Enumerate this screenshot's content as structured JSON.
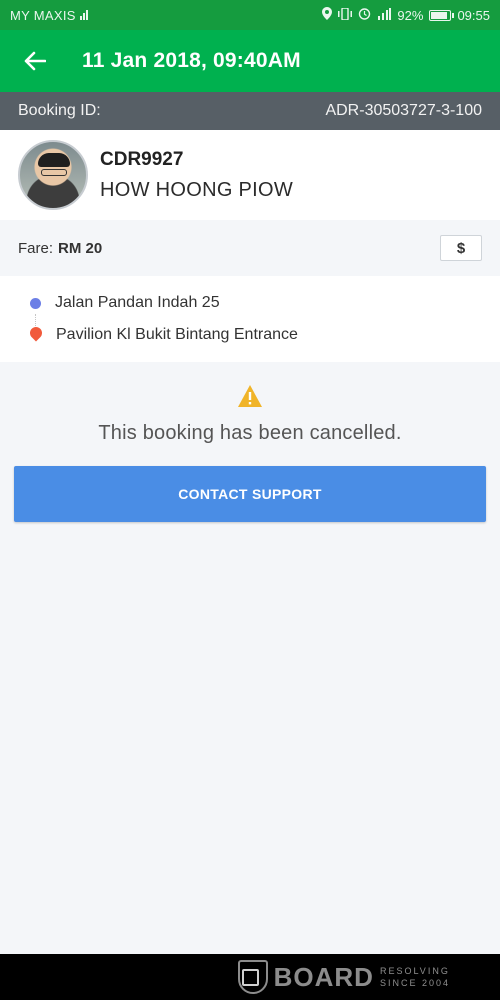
{
  "status_bar": {
    "carrier": "MY MAXIS",
    "battery_percent": "92%",
    "time": "09:55",
    "battery_level": 0.92
  },
  "header": {
    "title": "11 Jan 2018, 09:40AM",
    "back_icon": "arrow-left-icon"
  },
  "booking": {
    "id_label": "Booking ID:",
    "id_value": "ADR-30503727-3-100"
  },
  "driver": {
    "plate": "CDR9927",
    "name": "HOW HOONG PIOW"
  },
  "fare": {
    "label": "Fare:",
    "amount": "RM 20",
    "payment_icon": "dollar-icon",
    "payment_symbol": "$"
  },
  "route": {
    "pickup": "Jalan Pandan Indah 25",
    "dropoff": "Pavilion Kl Bukit Bintang Entrance",
    "pickup_color": "#6c7fe6",
    "dropoff_color": "#f15a3b"
  },
  "status": {
    "icon": "warning-icon",
    "message": "This booking has been cancelled.",
    "button_label": "CONTACT SUPPORT"
  },
  "watermark": {
    "brand": "BOARD",
    "tagline_line1": "RESOLVING",
    "tagline_line2": "SINCE 2004"
  },
  "colors": {
    "brand_green": "#00b14f",
    "status_green": "#159c3f",
    "button_blue": "#4a8de5",
    "booking_bar": "#575f66",
    "warning": "#f0b429"
  }
}
